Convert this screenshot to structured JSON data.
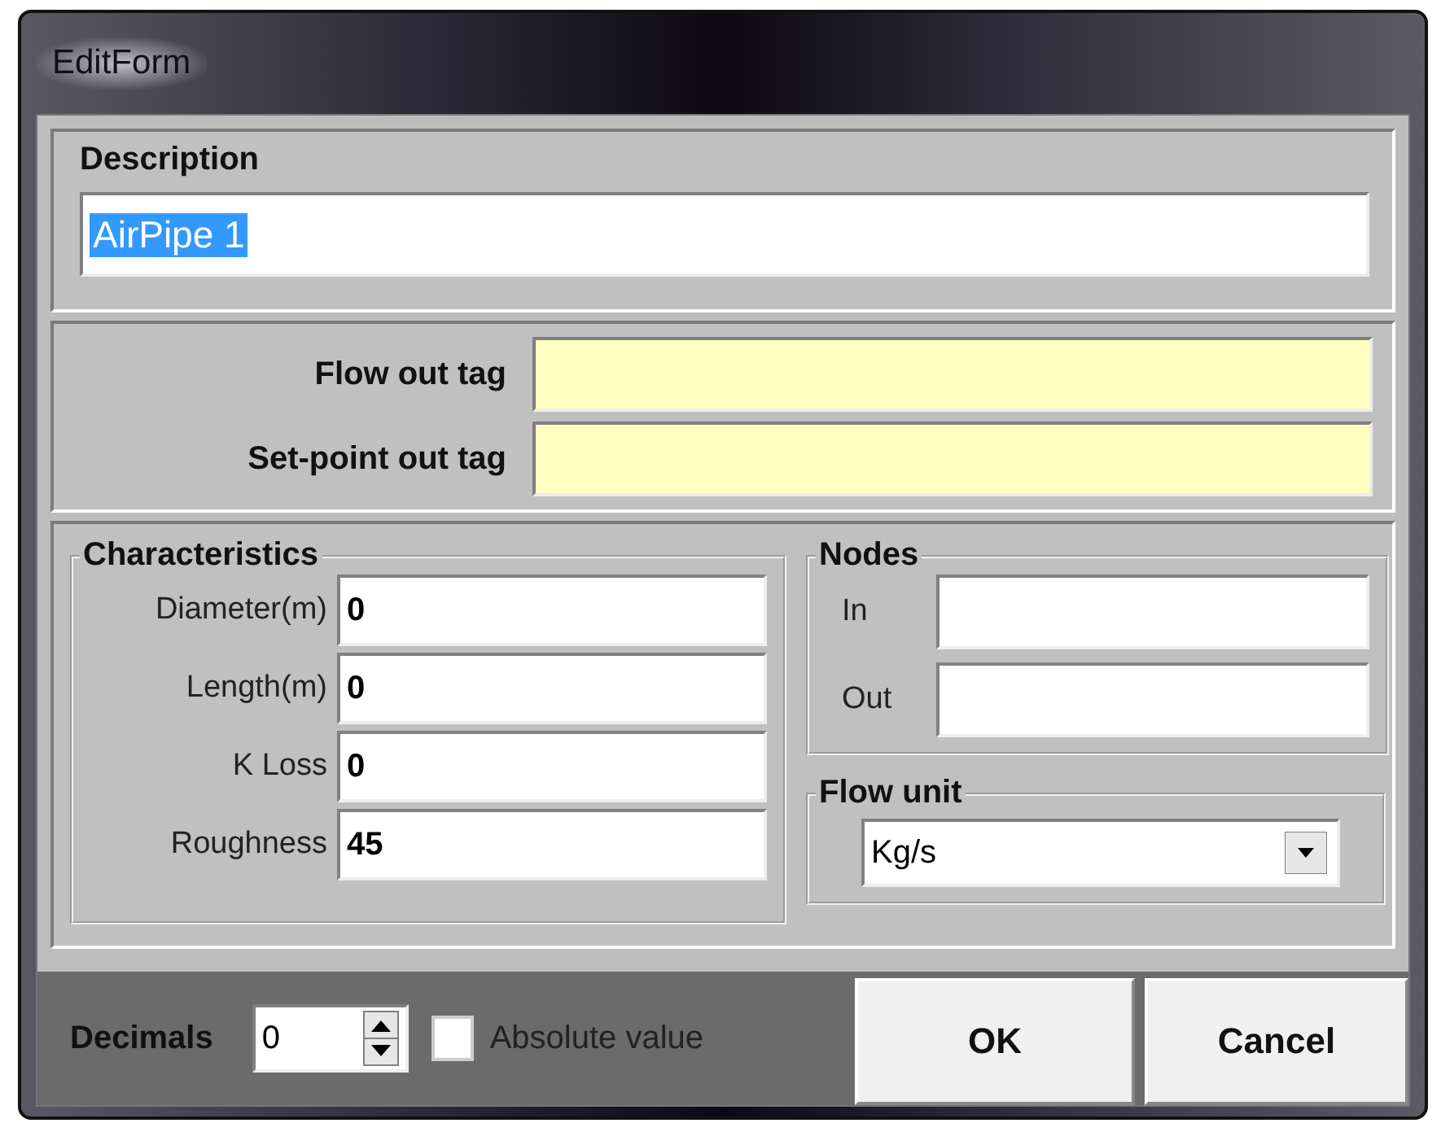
{
  "window": {
    "title": "EditForm"
  },
  "description": {
    "label": "Description",
    "value": "AirPipe 1",
    "selected": true
  },
  "tags": [
    {
      "label": "Flow out tag"
    },
    {
      "label": "Set-point out tag"
    }
  ],
  "characteristics": {
    "title": "Characteristics",
    "fields": [
      {
        "label": "Diameter(m)",
        "value": "0"
      },
      {
        "label": "Length(m)",
        "value": "0"
      },
      {
        "label": "K Loss",
        "value": "0"
      },
      {
        "label": "Roughness",
        "value": "45"
      }
    ]
  },
  "nodes": {
    "title": "Nodes",
    "fields": [
      {
        "label": "In"
      },
      {
        "label": "Out"
      }
    ]
  },
  "flow_unit": {
    "title": "Flow unit",
    "value": "Kg/s"
  },
  "footer": {
    "decimals_label": "Decimals",
    "decimals_value": "0",
    "checkbox": {
      "label": "Absolute value",
      "checked": false
    },
    "buttons": [
      "OK",
      "Cancel"
    ]
  }
}
